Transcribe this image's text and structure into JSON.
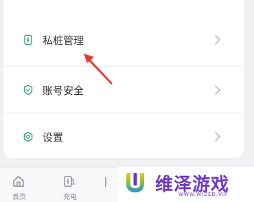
{
  "menu": {
    "items": [
      {
        "label": "私桩管理",
        "icon": "private-charger-icon"
      },
      {
        "label": "账号安全",
        "icon": "shield-icon"
      },
      {
        "label": "设置",
        "icon": "settings-gear-icon"
      }
    ]
  },
  "annotation": {
    "arrow_color": "#e53935"
  },
  "tabbar": {
    "tabs": [
      {
        "label": "首页",
        "icon": "home-icon"
      },
      {
        "label": "充电",
        "icon": "charging-icon"
      }
    ]
  },
  "watermark": {
    "text": "维泽游戏",
    "url": "WWW.WIZED.VIP",
    "color": "#6d38c9"
  },
  "colors": {
    "icon_green": "#2e9e6b",
    "chevron": "#b8bcc2"
  }
}
